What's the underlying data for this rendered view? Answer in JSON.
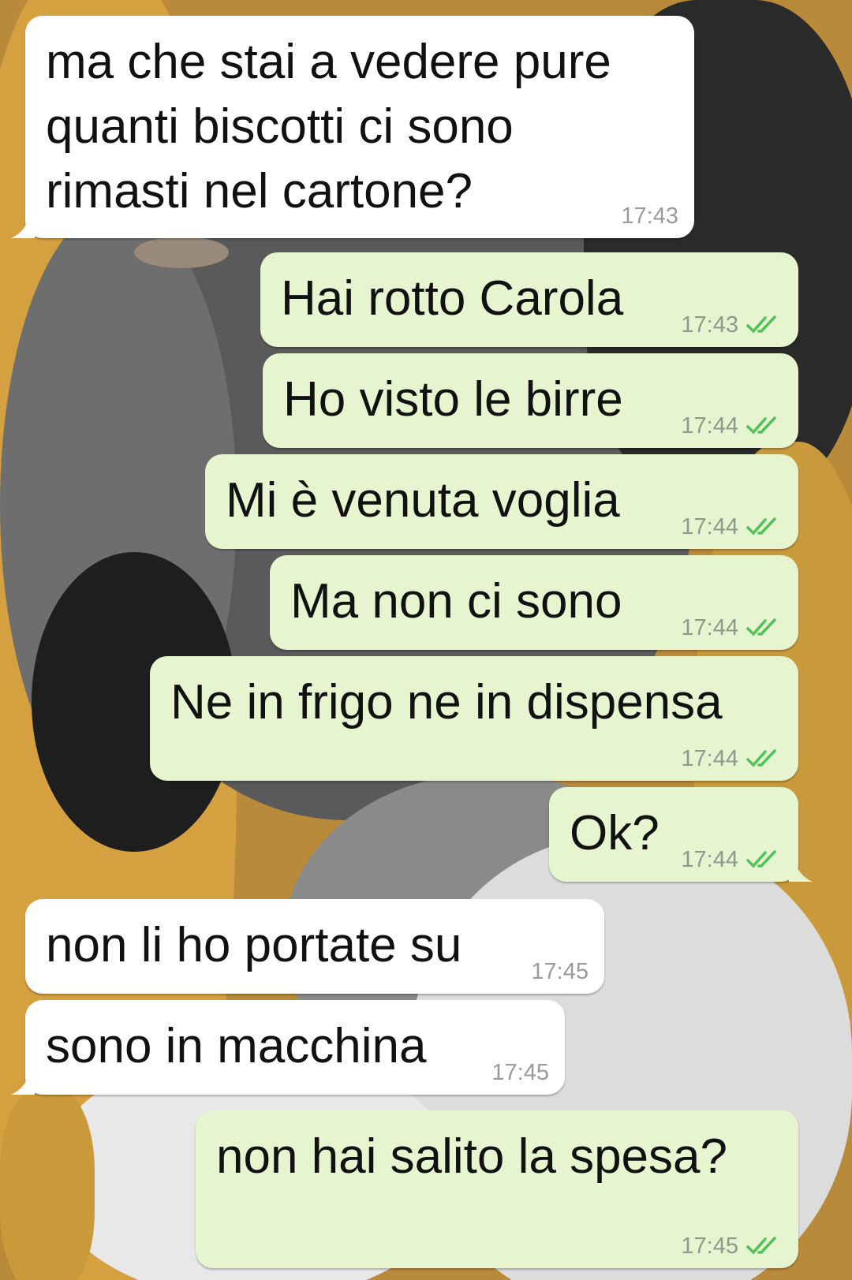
{
  "colors": {
    "incoming_bubble": "#ffffff",
    "outgoing_bubble": "#e6f5cf",
    "timestamp": "#8c9a8c",
    "read_ticks": "#4fc35a"
  },
  "chat": {
    "messages": [
      {
        "direction": "in",
        "text": "ma che stai a vedere pure\nquanti biscotti ci sono\nrimasti nel cartone?",
        "time": "17:43"
      },
      {
        "direction": "out",
        "text": "Hai rotto Carola",
        "time": "17:43",
        "status_icon": "double-check-icon"
      },
      {
        "direction": "out",
        "text": "Ho visto le birre",
        "time": "17:44",
        "status_icon": "double-check-icon"
      },
      {
        "direction": "out",
        "text": "Mi è venuta voglia",
        "time": "17:44",
        "status_icon": "double-check-icon"
      },
      {
        "direction": "out",
        "text": "Ma non ci sono",
        "time": "17:44",
        "status_icon": "double-check-icon"
      },
      {
        "direction": "out",
        "text": "Ne in frigo ne in dispensa",
        "time": "17:44",
        "status_icon": "double-check-icon"
      },
      {
        "direction": "out",
        "text": "Ok?",
        "time": "17:44",
        "status_icon": "double-check-icon"
      },
      {
        "direction": "in",
        "text": "non li ho portate su",
        "time": "17:45"
      },
      {
        "direction": "in",
        "text": "sono in macchina",
        "time": "17:45"
      },
      {
        "direction": "out",
        "text": "non hai salito la spesa?",
        "time": "17:45",
        "status_icon": "double-check-icon"
      }
    ]
  }
}
